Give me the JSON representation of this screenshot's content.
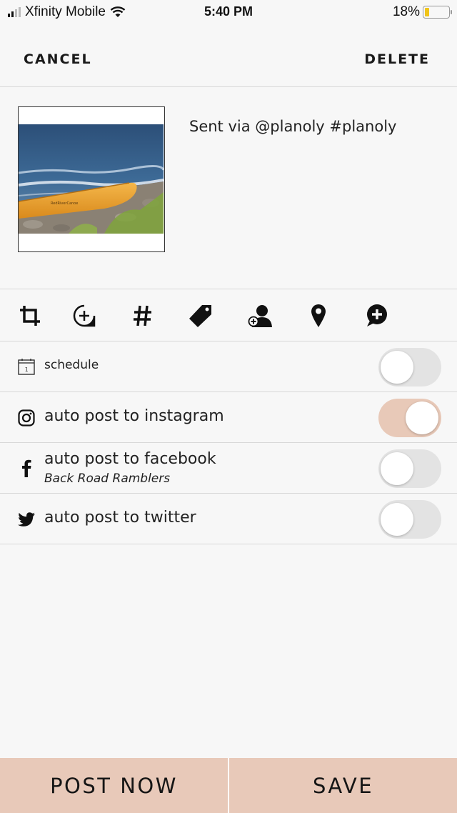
{
  "status_bar": {
    "carrier": "Xfinity Mobile",
    "time": "5:40 PM",
    "battery_percent": "18%",
    "battery_level": 0.18,
    "signal_bars_filled": 2,
    "signal_bars_total": 4
  },
  "header": {
    "cancel_label": "CANCEL",
    "delete_label": "DELETE"
  },
  "post": {
    "caption": "Sent via @planoly #planoly",
    "image_alt": "Yellow canoe on rocky lakeshore"
  },
  "toolbar": {
    "tools": [
      {
        "name": "crop",
        "icon": "crop-icon"
      },
      {
        "name": "zoom",
        "icon": "zoom-add-icon"
      },
      {
        "name": "hashtag",
        "icon": "hashtag-icon"
      },
      {
        "name": "tag",
        "icon": "tag-icon"
      },
      {
        "name": "tag-user",
        "icon": "user-add-icon"
      },
      {
        "name": "location",
        "icon": "location-pin-icon"
      },
      {
        "name": "add-comment",
        "icon": "comment-add-icon"
      }
    ]
  },
  "settings": {
    "schedule": {
      "label": "schedule",
      "enabled": false
    },
    "instagram": {
      "label": "auto post to instagram",
      "enabled": true
    },
    "facebook": {
      "label": "auto post to facebook",
      "account": "Back Road Ramblers",
      "enabled": false
    },
    "twitter": {
      "label": "auto post to twitter",
      "enabled": false
    }
  },
  "footer": {
    "post_now_label": "POST NOW",
    "save_label": "SAVE"
  },
  "colors": {
    "accent": "#e8c9b9",
    "background": "#f7f7f7",
    "toggle_off": "#e3e3e3",
    "battery_low": "#f0c419"
  }
}
